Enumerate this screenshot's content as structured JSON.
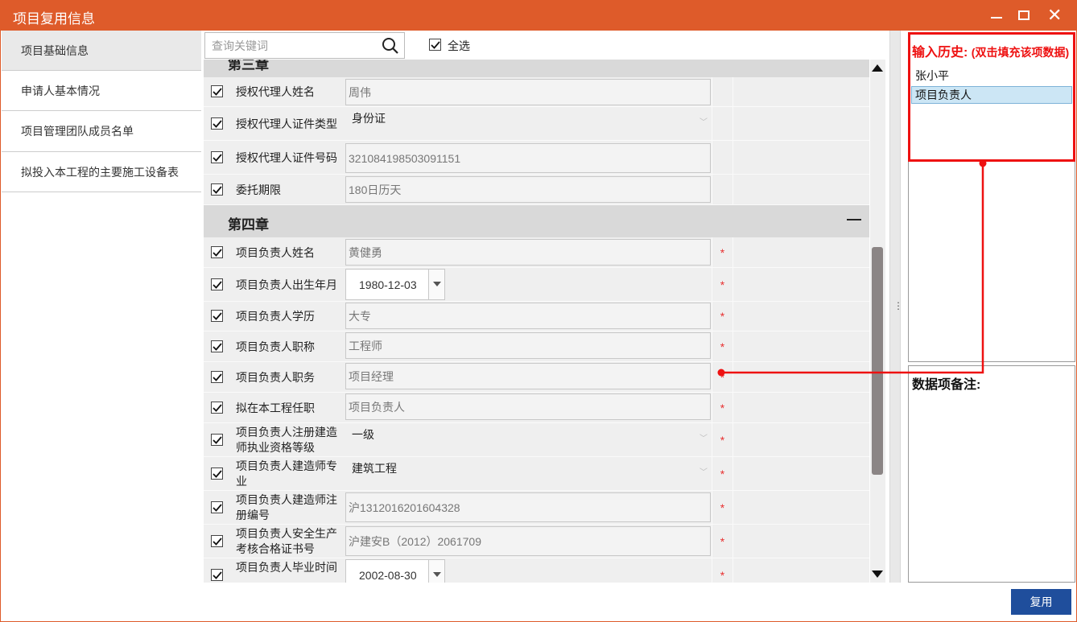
{
  "window": {
    "title": "项目复用信息"
  },
  "sidebar": {
    "items": [
      {
        "label": "项目基础信息"
      },
      {
        "label": "申请人基本情况"
      },
      {
        "label": "项目管理团队成员名单"
      },
      {
        "label": "拟投入本工程的主要施工设备表"
      }
    ]
  },
  "toolbar": {
    "search_placeholder": "查询关键词",
    "select_all_label": "全选"
  },
  "form": {
    "chapter3": {
      "title": "第三章",
      "rows": [
        {
          "label": "授权代理人姓名",
          "value": "周伟",
          "checked": true
        },
        {
          "label": "授权代理人证件类型",
          "value": "身份证",
          "checked": true
        },
        {
          "label": "授权代理人证件号码",
          "value": "321084198503091151",
          "checked": true
        },
        {
          "label": "委托期限",
          "value": "180日历天",
          "checked": true
        }
      ]
    },
    "chapter4": {
      "title": "第四章",
      "rows": [
        {
          "label": "项目负责人姓名",
          "value": "黄健勇",
          "required": "*",
          "checked": true
        },
        {
          "label": "项目负责人出生年月",
          "value": "1980-12-03",
          "required": "*",
          "checked": true
        },
        {
          "label": "项目负责人学历",
          "value": "大专",
          "required": "*",
          "checked": true
        },
        {
          "label": "项目负责人职称",
          "value": "工程师",
          "required": "*",
          "checked": true
        },
        {
          "label": "项目负责人职务",
          "value": "项目经理",
          "required": "*",
          "checked": true
        },
        {
          "label": "拟在本工程任职",
          "value": "项目负责人",
          "required": "*",
          "checked": true
        },
        {
          "label": "项目负责人注册建造师执业资格等级",
          "value": "一级",
          "required": "*",
          "checked": true
        },
        {
          "label": "项目负责人建造师专业",
          "value": "建筑工程",
          "required": "*",
          "checked": true
        },
        {
          "label": "项目负责人建造师注册编号",
          "value": "沪1312016201604328",
          "required": "*",
          "checked": true
        },
        {
          "label": "项目负责人安全生产考核合格证书号",
          "value": "沪建安B（2012）2061709",
          "required": "*",
          "checked": true
        },
        {
          "label": "项目负责人毕业时间",
          "value": "2002-08-30",
          "required": "*",
          "checked": true
        }
      ]
    }
  },
  "history": {
    "title": "输入历史:",
    "subtitle": "(双击填充该项数据)",
    "items": [
      {
        "label": "张小平",
        "selected": false
      },
      {
        "label": "项目负责人",
        "selected": true
      }
    ]
  },
  "note": {
    "title": "数据项备注:"
  },
  "actions": {
    "reuse_label": "复用"
  },
  "colors": {
    "titlebar": "#de5b2a",
    "highlight": "#ee1111",
    "button": "#1f4e9c",
    "required": "#e83030"
  }
}
